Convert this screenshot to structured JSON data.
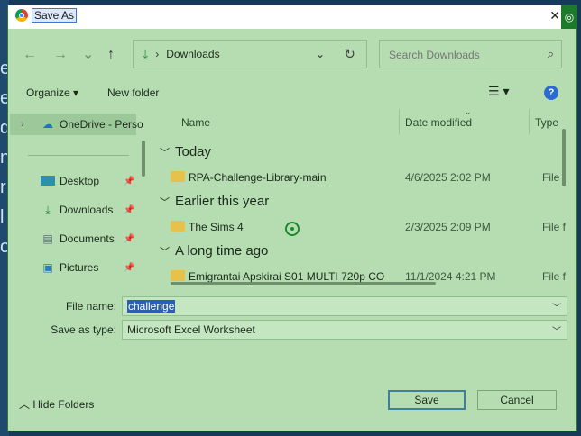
{
  "background": {
    "glyphs": [
      "e",
      "e",
      "d",
      "n",
      "r",
      "l",
      "o"
    ]
  },
  "window": {
    "title": "Save As",
    "close_symbol": "✕",
    "badge_symbol": "◎"
  },
  "navigation": {
    "back": "←",
    "forward": "→",
    "recent": "⌄",
    "up": "↑",
    "address": {
      "path": "Downloads",
      "separator": "›",
      "icon": "download-icon"
    },
    "search_placeholder": "Search Downloads"
  },
  "commandbar": {
    "organize": "Organize ▾",
    "new_folder": "New folder",
    "help": "?"
  },
  "sidebar": {
    "items": [
      {
        "label": "OneDrive - Perso",
        "icon": "cloud-icon",
        "pinned": false
      },
      {
        "label": "Desktop",
        "icon": "desktop-icon",
        "pinned": true
      },
      {
        "label": "Downloads",
        "icon": "download-icon",
        "pinned": true
      },
      {
        "label": "Documents",
        "icon": "document-icon",
        "pinned": true
      },
      {
        "label": "Pictures",
        "icon": "picture-icon",
        "pinned": true
      }
    ]
  },
  "file_list": {
    "columns": {
      "name": "Name",
      "date": "Date modified",
      "type": "Type"
    },
    "groups": [
      {
        "label": "Today",
        "rows": [
          {
            "name": "RPA-Challenge-Library-main",
            "date": "4/6/2025 2:02 PM",
            "type": "File f"
          }
        ]
      },
      {
        "label": "Earlier this year",
        "rows": [
          {
            "name": "The Sims 4",
            "date": "2/3/2025 2:09 PM",
            "type": "File f"
          }
        ]
      },
      {
        "label": "A long time ago",
        "rows": [
          {
            "name": "Emigrantai Apskirai S01 MULTI 720p CO",
            "date": "11/1/2024 4:21 PM",
            "type": "File f"
          }
        ]
      }
    ]
  },
  "form": {
    "file_name_label": "File name:",
    "file_name_value": "challenge",
    "save_type_label": "Save as type:",
    "save_type_value": "Microsoft Excel Worksheet"
  },
  "footer": {
    "hide_folders": "Hide Folders",
    "save": "Save",
    "cancel": "Cancel"
  }
}
